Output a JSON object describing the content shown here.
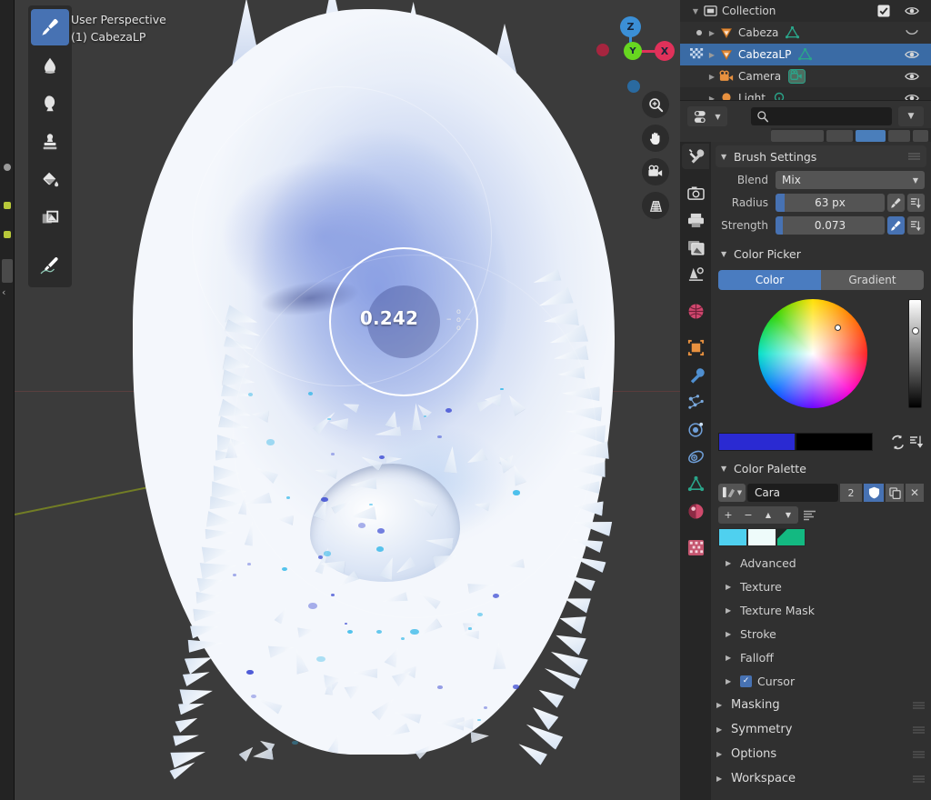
{
  "viewport": {
    "perspective_label": "User Perspective",
    "object_label": "(1) CabezaLP",
    "brush_cursor_value": "0.242",
    "gizmo": {
      "axis_z": "Z",
      "axis_x": "X",
      "axis_y": "Y"
    }
  },
  "toolbar": {
    "tools": [
      {
        "name": "draw-brush-tool",
        "icon": "brush-icon",
        "active": true
      },
      {
        "name": "blur-tool",
        "icon": "droplet-icon",
        "active": false
      },
      {
        "name": "smear-tool",
        "icon": "smear-icon",
        "active": false
      },
      {
        "name": "clone-tool",
        "icon": "stamp-icon",
        "active": false
      },
      {
        "name": "fill-tool",
        "icon": "paint-bucket-icon",
        "active": false
      },
      {
        "name": "mask-tool",
        "icon": "mask-image-icon",
        "active": false
      },
      {
        "name": "annotate-tool",
        "icon": "annotate-pen-icon",
        "active": false
      }
    ]
  },
  "viewport_side_buttons": [
    {
      "name": "zoom-button",
      "icon": "magnifier-plus-icon"
    },
    {
      "name": "pan-button",
      "icon": "hand-icon"
    },
    {
      "name": "camera-view-button",
      "icon": "camera-icon"
    },
    {
      "name": "toggle-ortho-button",
      "icon": "grid-perspective-icon"
    }
  ],
  "outliner": {
    "rows": [
      {
        "label": "Collection",
        "icon": "collection-icon",
        "indent": 0,
        "selected": false,
        "expanded": true,
        "checkbox": true,
        "visible_icon": "eye-open-icon",
        "data_icon": ""
      },
      {
        "label": "Cabeza",
        "icon": "mesh-object-icon",
        "indent": 1,
        "selected": false,
        "expanded": false,
        "checkbox": false,
        "visible_icon": "eye-closed-icon",
        "data_icon": "mesh-data-icon"
      },
      {
        "label": "CabezaLP",
        "icon": "mesh-object-icon",
        "indent": 1,
        "selected": true,
        "expanded": false,
        "checkbox": false,
        "visible_icon": "eye-open-icon",
        "data_icon": "mesh-data-icon"
      },
      {
        "label": "Camera",
        "icon": "camera-object-icon",
        "indent": 1,
        "selected": false,
        "expanded": false,
        "checkbox": false,
        "visible_icon": "eye-open-icon",
        "data_icon": "camera-data-icon"
      },
      {
        "label": "Light",
        "icon": "light-object-icon",
        "indent": 1,
        "selected": false,
        "expanded": false,
        "checkbox": false,
        "visible_icon": "eye-open-icon",
        "data_icon": "light-data-icon"
      }
    ],
    "search_placeholder": "",
    "filter_label": "filter-icon",
    "expand_label": "chevron-down-icon"
  },
  "properties": {
    "tabs": [
      {
        "name": "tool-tab",
        "icon": "tool-wrench-screwdriver-icon",
        "active": true
      },
      {
        "name": "render-tab",
        "icon": "camera-back-icon",
        "active": false
      },
      {
        "name": "output-tab",
        "icon": "printer-icon",
        "active": false
      },
      {
        "name": "view-layer-tab",
        "icon": "images-icon",
        "active": false
      },
      {
        "name": "scene-tab",
        "icon": "scene-cone-icon",
        "active": false
      },
      {
        "name": "world-tab",
        "icon": "world-globe-icon",
        "active": false
      },
      {
        "name": "object-tab",
        "icon": "object-square-icon",
        "active": false
      },
      {
        "name": "modifier-tab",
        "icon": "wrench-icon",
        "active": false
      },
      {
        "name": "particles-tab",
        "icon": "particles-icon",
        "active": false
      },
      {
        "name": "physics-tab",
        "icon": "physics-orbit-icon",
        "active": false
      },
      {
        "name": "constraints-tab",
        "icon": "constraint-icon",
        "active": false
      },
      {
        "name": "data-tab",
        "icon": "mesh-data-triangle-icon",
        "active": false
      },
      {
        "name": "material-tab",
        "icon": "material-sphere-icon",
        "active": false
      },
      {
        "name": "texture-tab",
        "icon": "texture-checker-icon",
        "active": false
      }
    ],
    "brush_settings": {
      "title": "Brush Settings",
      "blend_label": "Blend",
      "blend_value": "Mix",
      "radius_label": "Radius",
      "radius_value": "63 px",
      "radius_fill_pct": 8,
      "radius_pressure_on": false,
      "strength_label": "Strength",
      "strength_value": "0.073",
      "strength_fill_pct": 7,
      "strength_pressure_on": true
    },
    "color_picker": {
      "title": "Color Picker",
      "tab_color": "Color",
      "tab_gradient": "Gradient",
      "active_tab": "Color",
      "primary_color": "#2a2ad2",
      "secondary_color": "#000000",
      "swap_icon": "swap-colors-icon",
      "pressure_icon": "pressure-icon"
    },
    "color_palette": {
      "title": "Color Palette",
      "name": "Cara",
      "users_count": "2",
      "shield_icon": "fake-user-shield-icon",
      "copy_icon": "duplicate-icon",
      "close_icon": "unlink-x-icon",
      "add_label": "+",
      "remove_label": "−",
      "move_up_label": "▲",
      "move_down_label": "▼",
      "sort_icon": "sort-icon",
      "swatches": [
        "#4fd0ef",
        "#eefbfa",
        "#13b981"
      ]
    },
    "subpanels": [
      {
        "label": "Advanced",
        "checkbox": false
      },
      {
        "label": "Texture",
        "checkbox": false
      },
      {
        "label": "Texture Mask",
        "checkbox": false
      },
      {
        "label": "Stroke",
        "checkbox": false
      },
      {
        "label": "Falloff",
        "checkbox": false
      },
      {
        "label": "Cursor",
        "checkbox": true
      }
    ],
    "top_panels": [
      {
        "label": "Masking"
      },
      {
        "label": "Symmetry"
      },
      {
        "label": "Options"
      },
      {
        "label": "Workspace"
      }
    ]
  },
  "colors": {
    "accent_blue": "#4772b3",
    "select_blue": "#3a6ba5",
    "panel_bg": "#303030",
    "viewport_bg": "#3b3b3b"
  }
}
